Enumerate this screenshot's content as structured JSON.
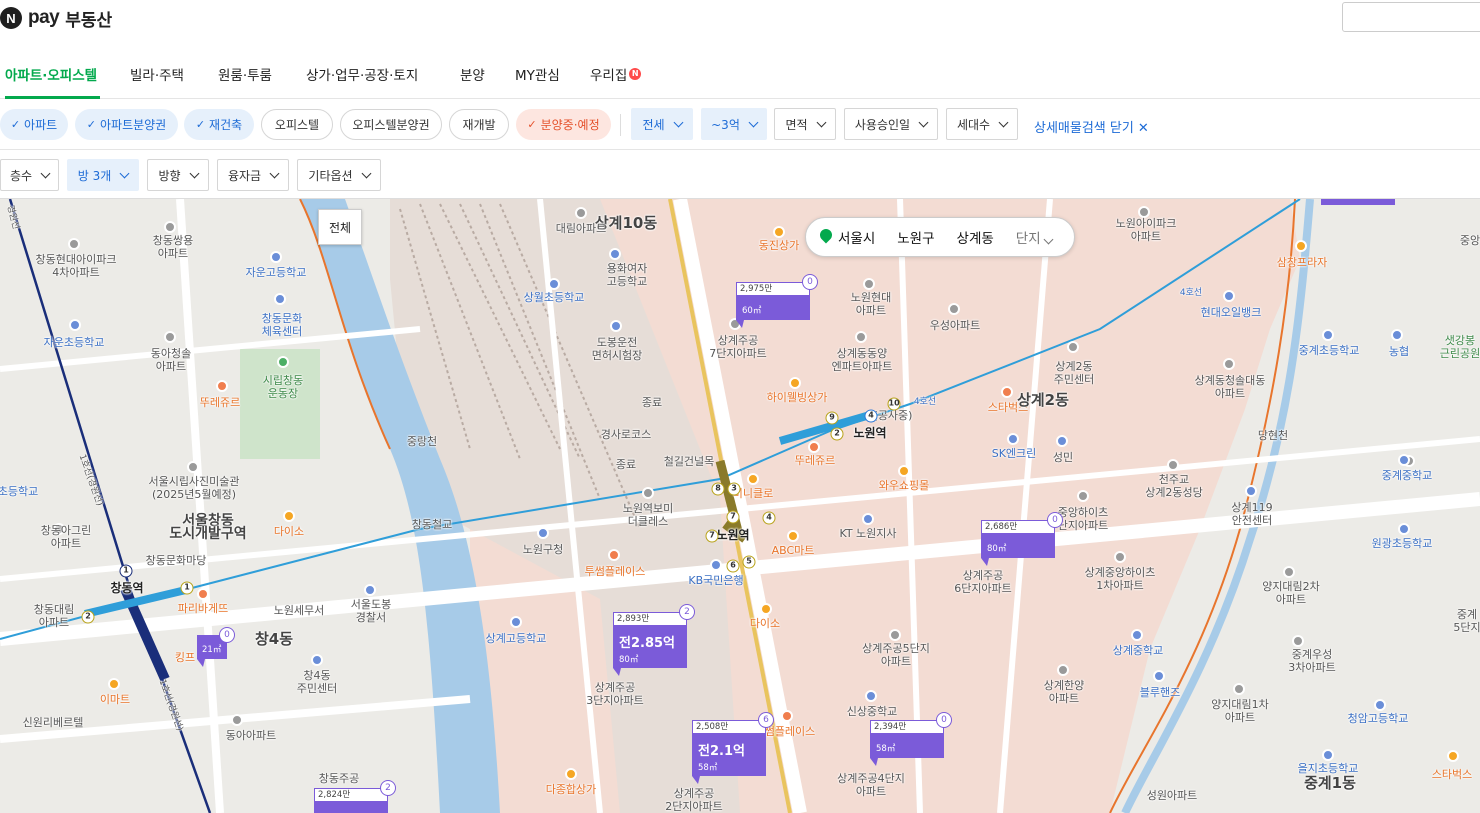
{
  "header": {
    "logo_n": "N",
    "logo_pay": "pay",
    "logo_text": "부동산"
  },
  "nav": {
    "tabs": [
      "아파트·오피스텔",
      "빌라·주택",
      "원룸·투룸",
      "상가·업무·공장·토지",
      "분양",
      "MY관심",
      "우리집"
    ],
    "new_badge": "N"
  },
  "filters1": {
    "chips": [
      "아파트",
      "아파트분양권",
      "재건축",
      "오피스텔",
      "오피스텔분양권",
      "재개발",
      "분양중·예정"
    ],
    "dropdowns": [
      "전세",
      "~3억",
      "면적",
      "사용승인일",
      "세대수"
    ],
    "close_search": "상세매물검색 닫기"
  },
  "filters2": {
    "dropdowns": [
      "층수",
      "방 3개",
      "방향",
      "융자금",
      "기타옵션"
    ]
  },
  "map": {
    "tooltip": "전체",
    "location": {
      "city": "서울시",
      "district": "노원구",
      "dong": "상계동",
      "unit": "단지"
    },
    "markers": [
      {
        "count": "2,975만",
        "price": "",
        "area": "60㎡",
        "badge": "0"
      },
      {
        "count": "2,686만",
        "price": "",
        "area": "80㎡",
        "badge": "0"
      },
      {
        "count": "2,893만",
        "price": "전2.85억",
        "area": "80㎡",
        "badge": "2"
      },
      {
        "count": "2,508만",
        "price": "전2.1억",
        "area": "58㎡",
        "badge": "6"
      },
      {
        "count": "2,394만",
        "price": "",
        "area": "58㎡",
        "badge": "0"
      },
      {
        "count": "",
        "price": "",
        "area": "21㎡",
        "badge": "0"
      },
      {
        "count": "2,824만",
        "price": "",
        "area": "",
        "badge": "2"
      }
    ],
    "labels": {
      "l01": "상계10동",
      "l02": "대림아파트",
      "l03": "동진상가",
      "l04": "노원아이파크\n아파트",
      "l05": "중앙",
      "l06": "삼창프라자",
      "l07": "창동쌍용\n아파트",
      "l08": "창동현대아이파크\n4차아파트",
      "l09": "자운고등학교",
      "l10": "용화여자\n고등학교",
      "l11": "상월초등학교",
      "l12": "노원현대\n아파트",
      "l13": "우성아파트",
      "l14": "현대오일뱅크",
      "l15": "중계초등학교",
      "l16": "농협",
      "l17": "샛강봉\n근린공원",
      "l18": "창동문화\n체육센터",
      "l19": "자운초등학교",
      "l20": "동아청솔\n아파트",
      "l21": "도봉운전\n면허시험장",
      "l22": "상계주공\n7단지아파트",
      "l23": "상계동동양\n엔파트아파트",
      "l24": "상계2동\n주민센터",
      "l25": "상계동청솔대동\n아파트",
      "l26": "시립창동\n운동장",
      "l27": "뚜레쥬르",
      "l28": "하이웰빙상가",
      "l29": "스타벅스",
      "l30": "상계2동",
      "l31": "중랑천",
      "l32": "종료",
      "l33": "경사로코스",
      "l34": "종료",
      "l35": "노원역",
      "l36": "(공사중)",
      "l37": "당현천",
      "l38": "철길건널목",
      "l39": "뚜레쥬르",
      "l40": "SK엔크린",
      "l41": "성민",
      "l42": "중계중학교",
      "l43": "서울시립사진미술관\n(2025년5월예정)",
      "l44": "와우쇼핑몰",
      "l45": "천주교\n상계2동성당",
      "l46": "상계119\n안전센터",
      "l47": "초등학교",
      "l48": "미니클로",
      "l49": "노원역보미\n더클레스",
      "l50": "중앙하이츠\n단지아파트",
      "l51": "창동아그린\n아파트",
      "l52": "서울창동\n도시개발구역",
      "l53": "다이소",
      "l54": "창동철교",
      "l55": "노원구청",
      "l56": "노원역",
      "l57": "ABC마트",
      "l58": "KT 노원지사",
      "l59": "원광초등학교",
      "l60": "창동문화마당",
      "l61": "투썸플레이스",
      "l62": "KB국민은행",
      "l63": "상계주공\n6단지아파트",
      "l64": "상계중앙하이츠\n1차아파트",
      "l65": "양지대림2차\n아파트",
      "l66": "중계\n5단지",
      "l67": "창동역",
      "l68": "파리바게뜨",
      "l69": "노원세무서",
      "l70": "서울도봉\n경찰서",
      "l71": "창동대림\n아파트",
      "l72": "다이소",
      "l73": "상계고등학교",
      "l74": "창4동",
      "l75": "상계주공5단지\n아파트",
      "l76": "상계중학교",
      "l77": "중계우성\n3차아파트",
      "l78": "킹프",
      "l79": "창4동\n주민센터",
      "l80": "이마트",
      "l81": "상계주공\n3단지아파트",
      "l82": "상계한양\n아파트",
      "l83": "블루핸즈",
      "l84": "양지대림1차\n아파트",
      "l85": "청암고등학교",
      "l86": "신원리베르텔",
      "l87": "동아아파트",
      "l88": "신상중학교",
      "l89": "썸플레이스",
      "l90": "창동주공",
      "l91": "다종합상가",
      "l92": "상계주공\n2단지아파트",
      "l93": "상계주공4단지\n아파트",
      "l94": "성원아파트",
      "l95": "을지초등학교",
      "l96": "중계1동",
      "l97": "스타벅스",
      "l98": "4호선",
      "l99": "4호선",
      "l100": "1호선(경원선)",
      "l101": "1호선(경원선)",
      "l102": "경원선"
    }
  }
}
